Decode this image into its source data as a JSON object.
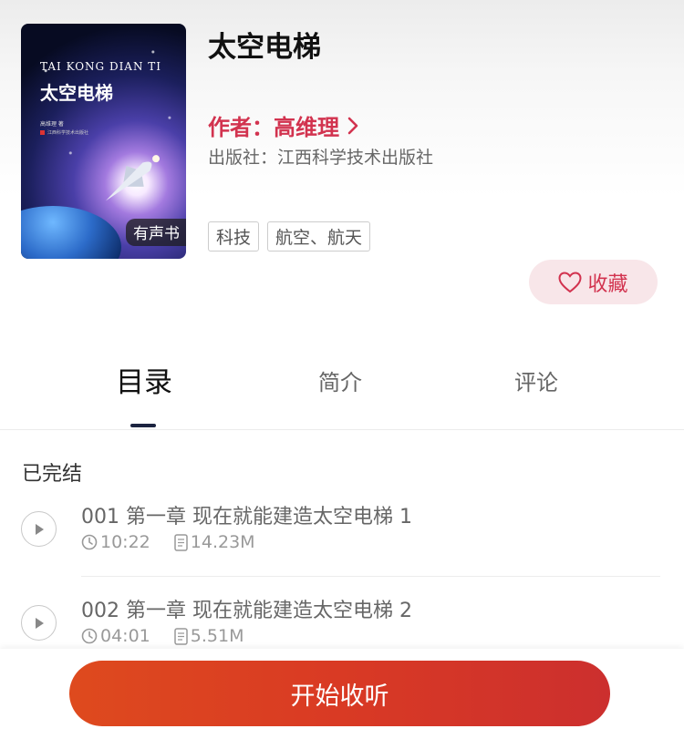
{
  "book": {
    "title": "太空电梯",
    "author": "作者：高维理",
    "publisher": "出版社：江西科学技术出版社",
    "tags": [
      "科技",
      "航空、航天"
    ],
    "audio_badge": "有声书",
    "cover": {
      "en_title": "TAI KONG DIAN TI",
      "cn_title": "太空电梯",
      "author_line": "高维理  著",
      "publisher_line": "江西科学技术出版社"
    }
  },
  "favorite": {
    "label": "收藏",
    "icon": "heart-outline-icon"
  },
  "tabs": [
    {
      "label": "目录",
      "active": true
    },
    {
      "label": "简介",
      "active": false
    },
    {
      "label": "评论",
      "active": false
    }
  ],
  "status": "已完结",
  "episodes": [
    {
      "title": "001 第一章 现在就能建造太空电梯 1",
      "duration": "10:22",
      "size": "14.23M"
    },
    {
      "title": "002 第一章 现在就能建造太空电梯 2",
      "duration": "04:01",
      "size": "5.51M"
    }
  ],
  "start_button": "开始收听",
  "colors": {
    "accent": "#d2334f",
    "button_start": "#de4a1e",
    "button_end": "#cc2f2e",
    "fav_bg": "#f8e6e9"
  }
}
